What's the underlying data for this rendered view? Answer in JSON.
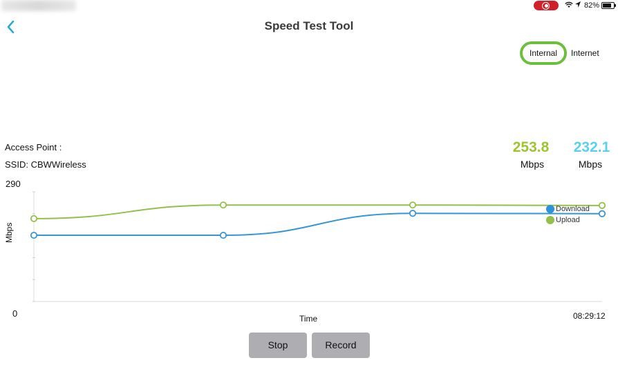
{
  "status_bar": {
    "battery_percent": "82%",
    "battery_level": 0.82,
    "icons": [
      "screen-recording-icon",
      "wifi-icon",
      "location-arrow-icon",
      "battery-icon"
    ]
  },
  "header": {
    "back_icon": "chevron-left-icon",
    "title": "Speed Test Tool"
  },
  "mode_toggle": {
    "options": [
      "Internal",
      "Internet"
    ],
    "selected": "Internal"
  },
  "info": {
    "access_point_label": "Access Point :",
    "ssid_label": "SSID: CBWWireless"
  },
  "readings": {
    "upload": {
      "value": "253.8",
      "unit": "Mbps",
      "color": "#9dc431"
    },
    "download": {
      "value": "232.1",
      "unit": "Mbps",
      "color": "#5bd0ec"
    }
  },
  "chart_data": {
    "type": "line",
    "title": "",
    "xlabel": "Time",
    "ylabel": "Mbps",
    "ylim": [
      0,
      290
    ],
    "y_tick_labels": [
      "290",
      "0"
    ],
    "x_end_label": "08:29:12",
    "x": [
      0,
      1,
      2,
      3
    ],
    "series": [
      {
        "name": "Download",
        "color": "#3497d3",
        "values": [
          175,
          175,
          233,
          232.1
        ]
      },
      {
        "name": "Upload",
        "color": "#93c048",
        "values": [
          219,
          255,
          255,
          253.8
        ]
      }
    ],
    "legend": [
      "Download",
      "Upload"
    ],
    "legend_placement": "right",
    "grid": false
  },
  "actions": {
    "stop_label": "Stop",
    "record_label": "Record"
  }
}
